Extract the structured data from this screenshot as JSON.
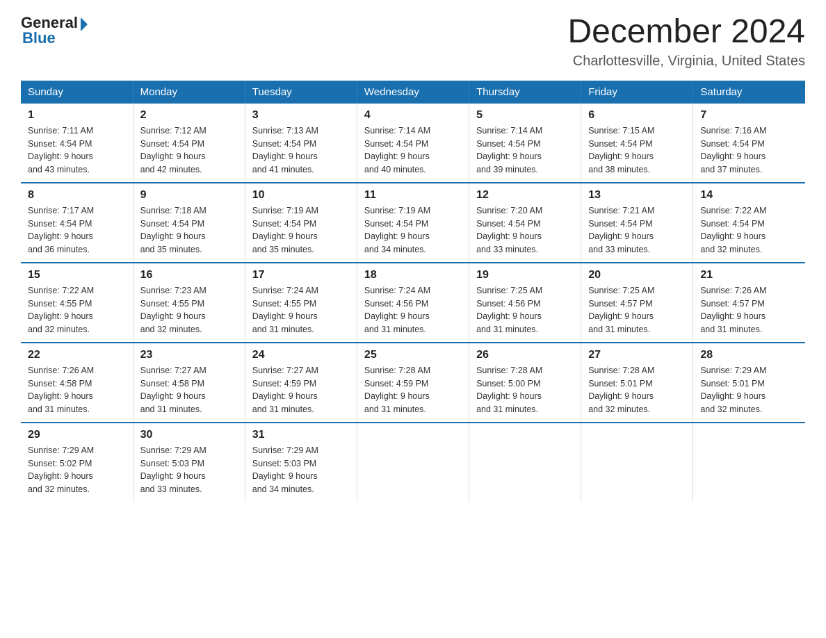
{
  "logo": {
    "general": "General",
    "blue": "Blue"
  },
  "title": "December 2024",
  "location": "Charlottesville, Virginia, United States",
  "headers": [
    "Sunday",
    "Monday",
    "Tuesday",
    "Wednesday",
    "Thursday",
    "Friday",
    "Saturday"
  ],
  "weeks": [
    [
      {
        "day": "1",
        "sunrise": "7:11 AM",
        "sunset": "4:54 PM",
        "daylight": "9 hours and 43 minutes."
      },
      {
        "day": "2",
        "sunrise": "7:12 AM",
        "sunset": "4:54 PM",
        "daylight": "9 hours and 42 minutes."
      },
      {
        "day": "3",
        "sunrise": "7:13 AM",
        "sunset": "4:54 PM",
        "daylight": "9 hours and 41 minutes."
      },
      {
        "day": "4",
        "sunrise": "7:14 AM",
        "sunset": "4:54 PM",
        "daylight": "9 hours and 40 minutes."
      },
      {
        "day": "5",
        "sunrise": "7:14 AM",
        "sunset": "4:54 PM",
        "daylight": "9 hours and 39 minutes."
      },
      {
        "day": "6",
        "sunrise": "7:15 AM",
        "sunset": "4:54 PM",
        "daylight": "9 hours and 38 minutes."
      },
      {
        "day": "7",
        "sunrise": "7:16 AM",
        "sunset": "4:54 PM",
        "daylight": "9 hours and 37 minutes."
      }
    ],
    [
      {
        "day": "8",
        "sunrise": "7:17 AM",
        "sunset": "4:54 PM",
        "daylight": "9 hours and 36 minutes."
      },
      {
        "day": "9",
        "sunrise": "7:18 AM",
        "sunset": "4:54 PM",
        "daylight": "9 hours and 35 minutes."
      },
      {
        "day": "10",
        "sunrise": "7:19 AM",
        "sunset": "4:54 PM",
        "daylight": "9 hours and 35 minutes."
      },
      {
        "day": "11",
        "sunrise": "7:19 AM",
        "sunset": "4:54 PM",
        "daylight": "9 hours and 34 minutes."
      },
      {
        "day": "12",
        "sunrise": "7:20 AM",
        "sunset": "4:54 PM",
        "daylight": "9 hours and 33 minutes."
      },
      {
        "day": "13",
        "sunrise": "7:21 AM",
        "sunset": "4:54 PM",
        "daylight": "9 hours and 33 minutes."
      },
      {
        "day": "14",
        "sunrise": "7:22 AM",
        "sunset": "4:54 PM",
        "daylight": "9 hours and 32 minutes."
      }
    ],
    [
      {
        "day": "15",
        "sunrise": "7:22 AM",
        "sunset": "4:55 PM",
        "daylight": "9 hours and 32 minutes."
      },
      {
        "day": "16",
        "sunrise": "7:23 AM",
        "sunset": "4:55 PM",
        "daylight": "9 hours and 32 minutes."
      },
      {
        "day": "17",
        "sunrise": "7:24 AM",
        "sunset": "4:55 PM",
        "daylight": "9 hours and 31 minutes."
      },
      {
        "day": "18",
        "sunrise": "7:24 AM",
        "sunset": "4:56 PM",
        "daylight": "9 hours and 31 minutes."
      },
      {
        "day": "19",
        "sunrise": "7:25 AM",
        "sunset": "4:56 PM",
        "daylight": "9 hours and 31 minutes."
      },
      {
        "day": "20",
        "sunrise": "7:25 AM",
        "sunset": "4:57 PM",
        "daylight": "9 hours and 31 minutes."
      },
      {
        "day": "21",
        "sunrise": "7:26 AM",
        "sunset": "4:57 PM",
        "daylight": "9 hours and 31 minutes."
      }
    ],
    [
      {
        "day": "22",
        "sunrise": "7:26 AM",
        "sunset": "4:58 PM",
        "daylight": "9 hours and 31 minutes."
      },
      {
        "day": "23",
        "sunrise": "7:27 AM",
        "sunset": "4:58 PM",
        "daylight": "9 hours and 31 minutes."
      },
      {
        "day": "24",
        "sunrise": "7:27 AM",
        "sunset": "4:59 PM",
        "daylight": "9 hours and 31 minutes."
      },
      {
        "day": "25",
        "sunrise": "7:28 AM",
        "sunset": "4:59 PM",
        "daylight": "9 hours and 31 minutes."
      },
      {
        "day": "26",
        "sunrise": "7:28 AM",
        "sunset": "5:00 PM",
        "daylight": "9 hours and 31 minutes."
      },
      {
        "day": "27",
        "sunrise": "7:28 AM",
        "sunset": "5:01 PM",
        "daylight": "9 hours and 32 minutes."
      },
      {
        "day": "28",
        "sunrise": "7:29 AM",
        "sunset": "5:01 PM",
        "daylight": "9 hours and 32 minutes."
      }
    ],
    [
      {
        "day": "29",
        "sunrise": "7:29 AM",
        "sunset": "5:02 PM",
        "daylight": "9 hours and 32 minutes."
      },
      {
        "day": "30",
        "sunrise": "7:29 AM",
        "sunset": "5:03 PM",
        "daylight": "9 hours and 33 minutes."
      },
      {
        "day": "31",
        "sunrise": "7:29 AM",
        "sunset": "5:03 PM",
        "daylight": "9 hours and 34 minutes."
      },
      null,
      null,
      null,
      null
    ]
  ],
  "labels": {
    "sunrise": "Sunrise:",
    "sunset": "Sunset:",
    "daylight": "Daylight:"
  }
}
